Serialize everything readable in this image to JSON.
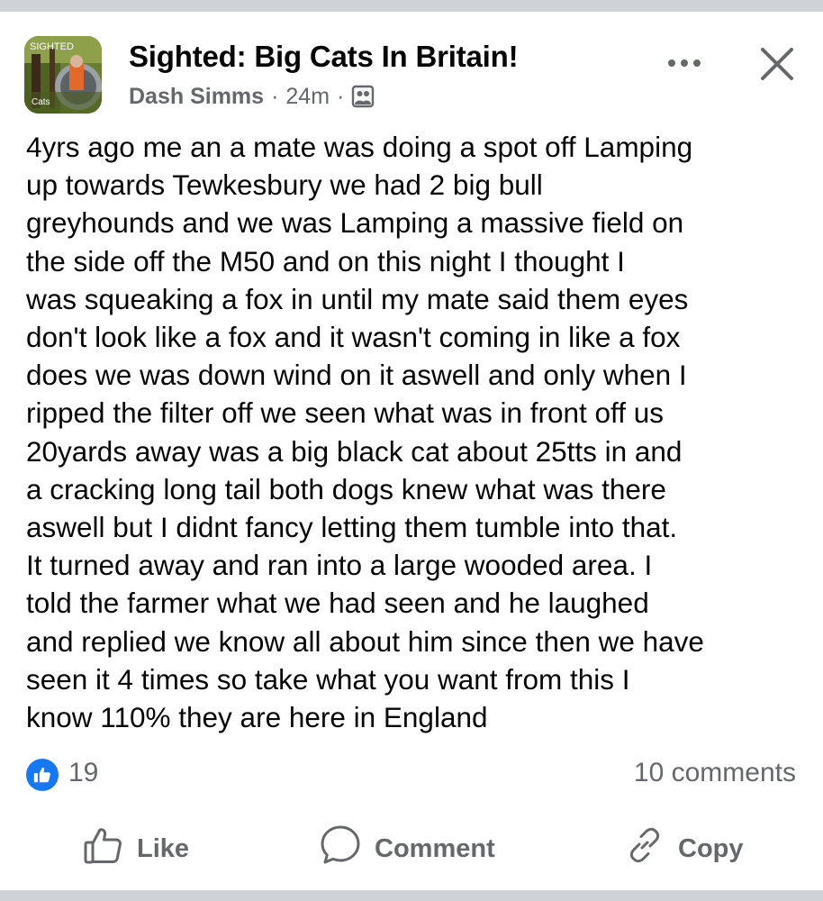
{
  "post": {
    "group_name": "Sighted: Big Cats In Britain!",
    "author": "Dash Simms",
    "time_ago": "24m",
    "separator": "·",
    "avatar_text_top": "SIGHTED",
    "avatar_text_bottom": "Cats",
    "body": "4yrs ago me an a mate was doing a spot off Lamping\nup towards Tewkesbury we had 2 big bull\ngreyhounds and we was Lamping a massive field on\nthe side off the  M50  and on this night I thought I\nwas squeaking a fox in until my mate said them eyes\ndon't look like a fox and it wasn't coming in like a fox\ndoes we was down wind on it aswell and only when I\nripped the filter off we seen what was in front off us\n20yards away was a big black cat about 25tts in and\na cracking long tail both dogs knew what was there\naswell but I didnt fancy letting them tumble into that.\nIt turned away and ran into a large wooded area.  I\ntold the farmer what we had seen and he laughed\nand replied we know all about him since then we have\nseen it 4 times so take what you want from this I\nknow 110% they are here in England"
  },
  "stats": {
    "like_count": "19",
    "comments": "10 comments"
  },
  "actions": {
    "like_label": "Like",
    "comment_label": "Comment",
    "copy_label": "Copy"
  },
  "icons": {
    "more": "more-horizontal-icon",
    "close": "close-icon",
    "group": "group-icon",
    "like_badge": "thumbs-up-badge-icon",
    "like": "thumbs-up-icon",
    "comment": "comment-bubble-icon",
    "copy": "link-icon"
  },
  "colors": {
    "text": "#050505",
    "secondary": "#65676b",
    "like_blue": "#1877f2",
    "divider": "#cfd2d6"
  }
}
